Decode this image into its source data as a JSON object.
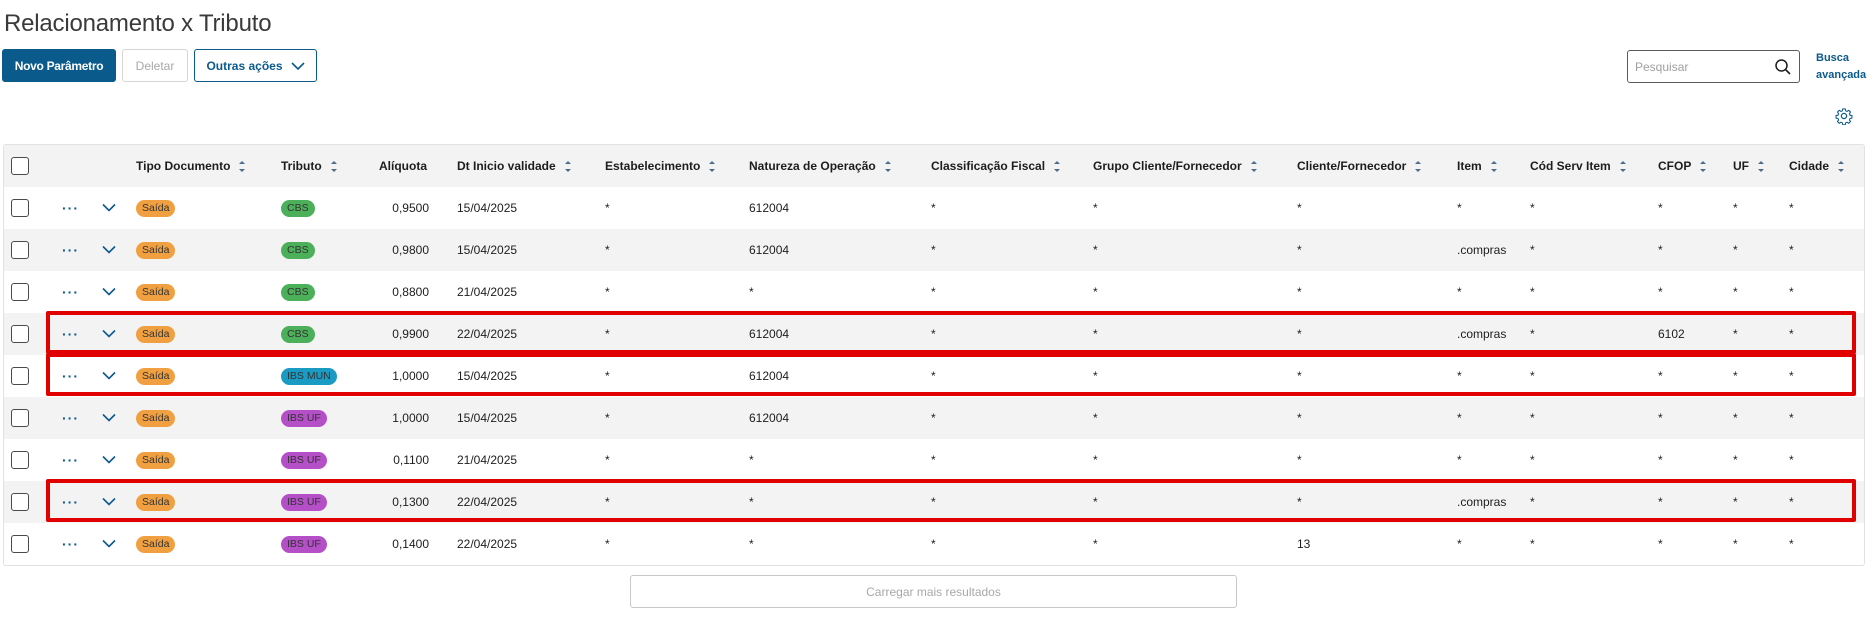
{
  "page": {
    "title": "Relacionamento x Tributo"
  },
  "toolbar": {
    "new_label": "Novo Parâmetro",
    "delete_label": "Deletar",
    "more_label": "Outras ações"
  },
  "search": {
    "placeholder": "Pesquisar",
    "advanced_label_line1": "Busca",
    "advanced_label_line2": "avançada"
  },
  "table": {
    "headers": {
      "tipo": "Tipo Documento",
      "tributo": "Tributo",
      "aliquota": "Alíquota",
      "dt": "Dt Inicio validade",
      "estab": "Estabelecimento",
      "natureza": "Natureza de Operação",
      "classif": "Classificação Fiscal",
      "grupo": "Grupo Cliente/Fornecedor",
      "cliente": "Cliente/Fornecedor",
      "item": "Item",
      "codserv": "Cód Serv Item",
      "cfop": "CFOP",
      "uf": "UF",
      "cidade": "Cidade"
    },
    "rows": [
      {
        "tipo": "Saída",
        "tributo": "CBS",
        "tributo_color": "#4cb05a",
        "aliquota": "0,9500",
        "dt": "15/04/2025",
        "estab": "*",
        "natureza": "612004",
        "classif": "*",
        "grupo": "*",
        "cliente": "*",
        "item": "*",
        "codserv": "*",
        "cfop": "*",
        "uf": "*",
        "cidade": "*"
      },
      {
        "tipo": "Saída",
        "tributo": "CBS",
        "tributo_color": "#4cb05a",
        "aliquota": "0,9800",
        "dt": "15/04/2025",
        "estab": "*",
        "natureza": "612004",
        "classif": "*",
        "grupo": "*",
        "cliente": "*",
        "item": ".compras",
        "codserv": "*",
        "cfop": "*",
        "uf": "*",
        "cidade": "*"
      },
      {
        "tipo": "Saída",
        "tributo": "CBS",
        "tributo_color": "#4cb05a",
        "aliquota": "0,8800",
        "dt": "21/04/2025",
        "estab": "*",
        "natureza": "*",
        "classif": "*",
        "grupo": "*",
        "cliente": "*",
        "item": "*",
        "codserv": "*",
        "cfop": "*",
        "uf": "*",
        "cidade": "*"
      },
      {
        "tipo": "Saída",
        "tributo": "CBS",
        "tributo_color": "#4cb05a",
        "aliquota": "0,9900",
        "dt": "22/04/2025",
        "estab": "*",
        "natureza": "612004",
        "classif": "*",
        "grupo": "*",
        "cliente": "*",
        "item": ".compras",
        "codserv": "*",
        "cfop": "6102",
        "uf": "*",
        "cidade": "*"
      },
      {
        "tipo": "Saída",
        "tributo": "IBS MUN",
        "tributo_color": "#1a9bc4",
        "aliquota": "1,0000",
        "dt": "15/04/2025",
        "estab": "*",
        "natureza": "612004",
        "classif": "*",
        "grupo": "*",
        "cliente": "*",
        "item": "*",
        "codserv": "*",
        "cfop": "*",
        "uf": "*",
        "cidade": "*"
      },
      {
        "tipo": "Saída",
        "tributo": "IBS UF",
        "tributo_color": "#b44fc8",
        "aliquota": "1,0000",
        "dt": "15/04/2025",
        "estab": "*",
        "natureza": "612004",
        "classif": "*",
        "grupo": "*",
        "cliente": "*",
        "item": "*",
        "codserv": "*",
        "cfop": "*",
        "uf": "*",
        "cidade": "*"
      },
      {
        "tipo": "Saída",
        "tributo": "IBS UF",
        "tributo_color": "#b44fc8",
        "aliquota": "0,1100",
        "dt": "21/04/2025",
        "estab": "*",
        "natureza": "*",
        "classif": "*",
        "grupo": "*",
        "cliente": "*",
        "item": "*",
        "codserv": "*",
        "cfop": "*",
        "uf": "*",
        "cidade": "*"
      },
      {
        "tipo": "Saída",
        "tributo": "IBS UF",
        "tributo_color": "#b44fc8",
        "aliquota": "0,1300",
        "dt": "22/04/2025",
        "estab": "*",
        "natureza": "*",
        "classif": "*",
        "grupo": "*",
        "cliente": "*",
        "item": ".compras",
        "codserv": "*",
        "cfop": "*",
        "uf": "*",
        "cidade": "*"
      },
      {
        "tipo": "Saída",
        "tributo": "IBS UF",
        "tributo_color": "#b44fc8",
        "aliquota": "0,1400",
        "dt": "22/04/2025",
        "estab": "*",
        "natureza": "*",
        "classif": "*",
        "grupo": "*",
        "cliente": "13",
        "item": "*",
        "codserv": "*",
        "cfop": "*",
        "uf": "*",
        "cidade": "*"
      }
    ],
    "highlighted_rows": [
      3,
      4,
      7
    ]
  },
  "load_more_label": "Carregar mais resultados",
  "colors": {
    "accent": "#0b5a8c",
    "saida_tag": "#f0a040",
    "highlight": "#e00000"
  },
  "icons": {
    "search": "search-icon",
    "settings": "gear-icon",
    "chevron": "chevron-down-icon",
    "more": "more-actions-icon"
  }
}
